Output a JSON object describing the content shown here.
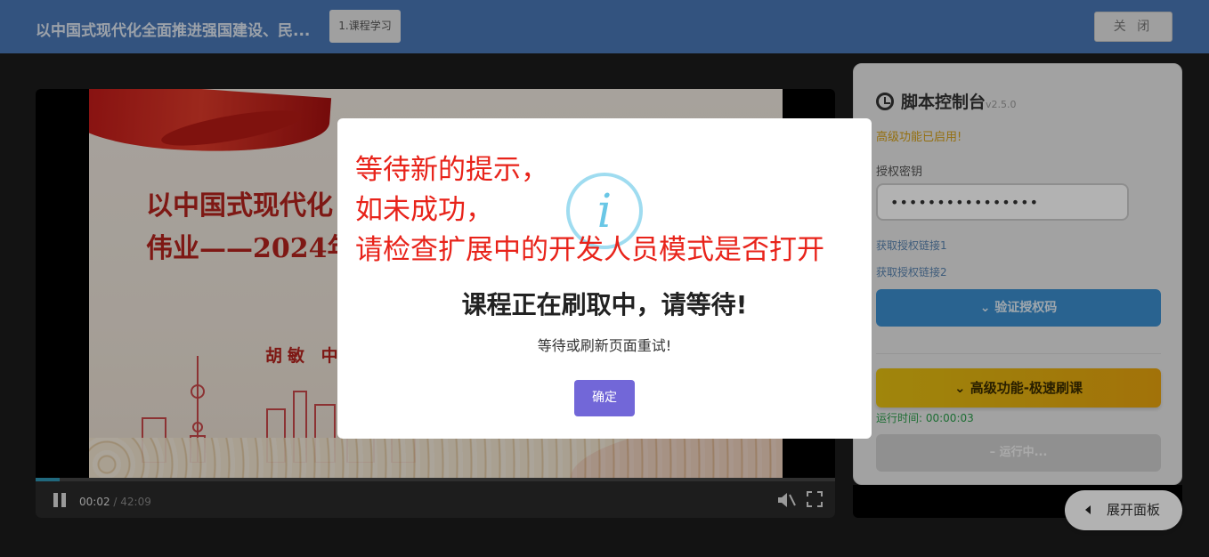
{
  "header": {
    "title": "以中国式现代化全面推进强国建设、民...",
    "tab_label": "1.课程学习",
    "close_label": "关 闭"
  },
  "video": {
    "slide_title_line1": "以中国式现代化",
    "slide_title_line2": "伟业——2024年",
    "slide_author": "胡敏 中",
    "current_time": "00:02",
    "duration": "/ 42:09",
    "progress_fraction": 0.03
  },
  "panel": {
    "title": "脚本控制台",
    "version": "v2.5.0",
    "status": "高级功能已启用!",
    "key_label": "授权密钥",
    "key_value": "••••••••••••••••",
    "link1": "获取授权链接1",
    "link2": "获取授权链接2",
    "verify_label": "验证授权码",
    "turbo_label": "高级功能-极速刷课",
    "runtime": "运行时间: 00:00:03",
    "running_label": "运行中...",
    "expand_label": "展开面板"
  },
  "modal": {
    "warn_line1": "等待新的提示，",
    "warn_line2": "如未成功，",
    "warn_line3": "请检查扩展中的开发人员模式是否打开",
    "icon_glyph": "i",
    "title": "课程正在刷取中，请等待!",
    "subtitle": "等待或刷新页面重试!",
    "ok_label": "确定"
  },
  "colors": {
    "header_bg": "#4a78b6",
    "verify_bg": "#3b8fcf",
    "turbo_bg": "#e5c012",
    "ok_bg": "#7267d8",
    "warn_text": "#e8231a"
  }
}
